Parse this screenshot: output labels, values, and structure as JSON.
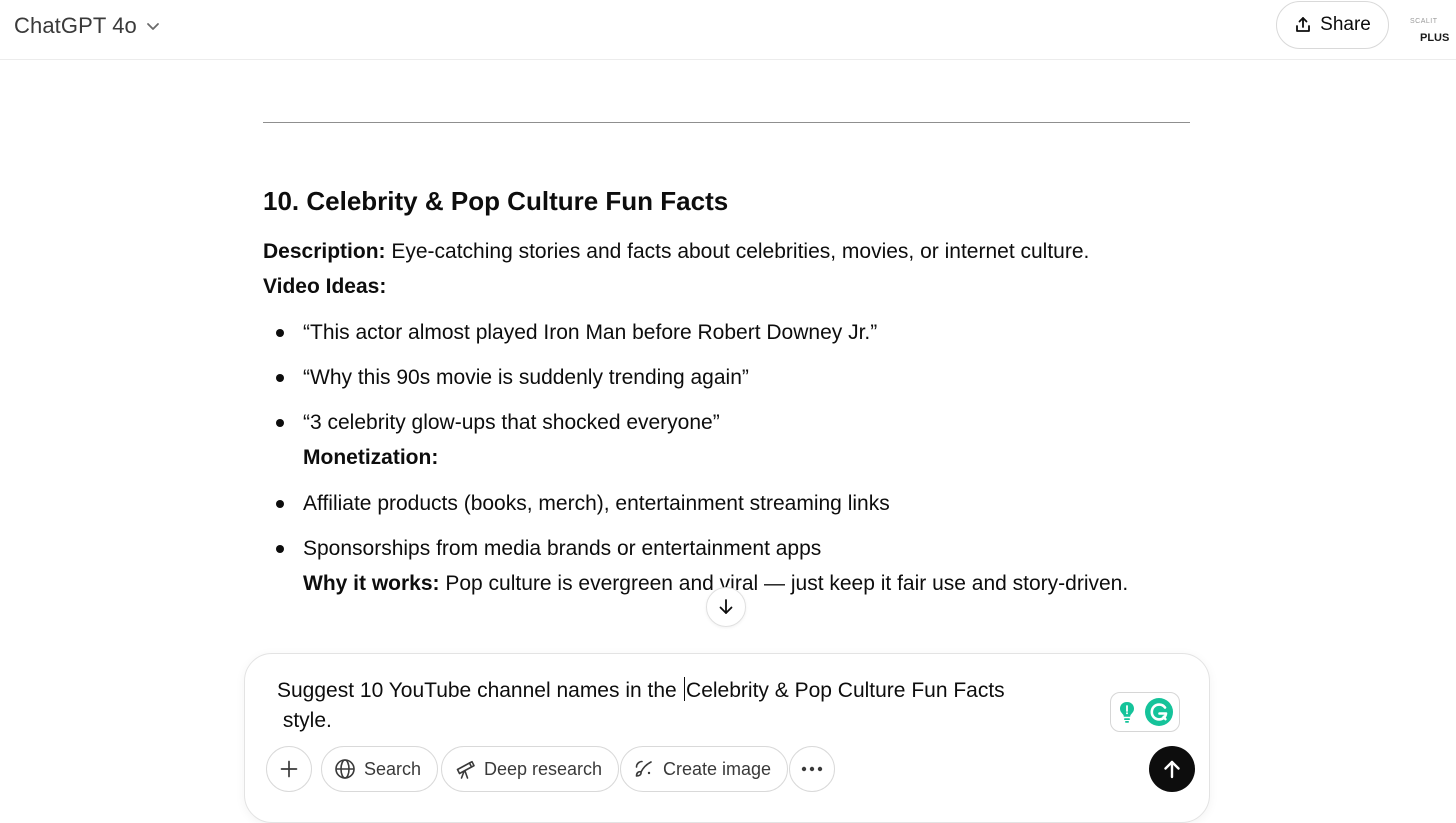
{
  "header": {
    "model_name": "ChatGPT 4o",
    "share_label": "Share",
    "account_small": "SCALIT",
    "account_plan": "PLUS"
  },
  "content": {
    "heading": "10. Celebrity & Pop Culture Fun Facts",
    "description_label": "Description:",
    "description_text": " Eye-catching stories and facts about celebrities, movies, or internet culture.",
    "video_ideas_label": "Video Ideas:",
    "video_ideas": [
      "“This actor almost played Iron Man before Robert Downey Jr.”",
      "“Why this 90s movie is suddenly trending again”",
      "“3 celebrity glow-ups that shocked everyone”"
    ],
    "monetization_label": "Monetization:",
    "monetization": [
      "Affiliate products (books, merch), entertainment streaming links",
      "Sponsorships from media brands or entertainment apps"
    ],
    "why_label": "Why it works:",
    "why_text": " Pop culture is evergreen and viral — just keep it fair use and story-driven."
  },
  "composer": {
    "text_before_caret": "Suggest 10 YouTube channel names in the ",
    "text_after_caret": "Celebrity & Pop Culture Fun Facts",
    "text_line2": " style.",
    "tools": {
      "search": "Search",
      "deep_research": "Deep research",
      "create_image": "Create image"
    }
  },
  "icons": {
    "model_chevron": "chevron-down-icon",
    "share": "share-upload-icon",
    "scroll": "arrow-down-icon",
    "plus": "plus-icon",
    "search": "globe-icon",
    "deep_research": "telescope-icon",
    "create_image": "image-brush-icon",
    "more": "more-dots-icon",
    "send": "arrow-up-icon",
    "grammarly_idea": "lightbulb-icon",
    "grammarly": "grammarly-icon"
  },
  "colors": {
    "text": "#0d0d0d",
    "send_button": "#0d0d0d",
    "grammarly_green": "#15c39a"
  }
}
